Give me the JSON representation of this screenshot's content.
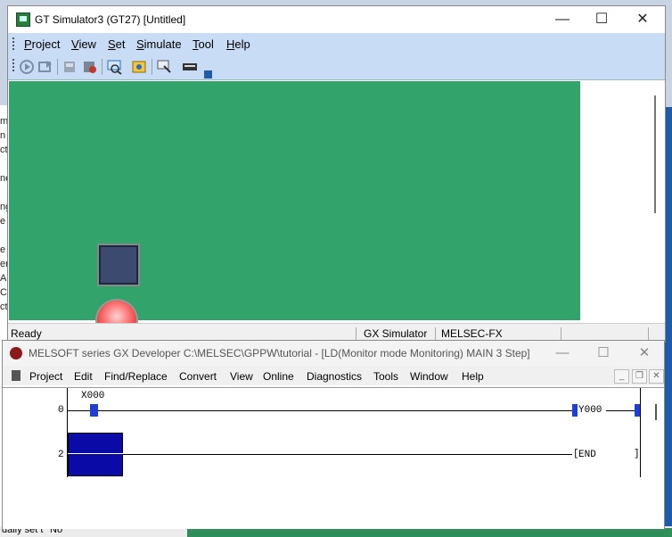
{
  "background": {
    "left_fragments": [
      "m",
      "n",
      "ct",
      "ne",
      "ng",
      "e",
      "e",
      "er",
      "A",
      "Co",
      "ct"
    ],
    "bottom_left_text": "daily set t",
    "bottom_left_value": "No"
  },
  "gt_window": {
    "title": "GT Simulator3 (GT27)  [Untitled]",
    "controls": {
      "minimize": "—",
      "maximize": "☐",
      "close": "✕"
    },
    "menu": [
      "Project",
      "View",
      "Set",
      "Simulate",
      "Tool",
      "Help"
    ],
    "menu_mnemonics": [
      "P",
      "V",
      "S",
      "S",
      "T",
      "H"
    ],
    "toolbar_icons": [
      "start-icon",
      "stop-icon",
      "read-icon",
      "write-icon",
      "device-monitor-icon",
      "snapshot-icon",
      "touch-icon",
      "keyboard-icon"
    ],
    "screen_color": "#31a36b",
    "status": {
      "left": "Ready",
      "center": "GX Simulator",
      "right": "MELSEC-FX"
    }
  },
  "gx_window": {
    "title": "MELSOFT series GX Developer C:\\MELSEC\\GPPW\\tutorial - [LD(Monitor mode Monitoring)    MAIN    3 Step]",
    "controls": {
      "minimize": "—",
      "maximize": "☐",
      "close": "✕"
    },
    "menu": [
      "Project",
      "Edit",
      "Find/Replace",
      "Convert",
      "View",
      "Online",
      "Diagnostics",
      "Tools",
      "Window",
      "Help"
    ],
    "mdi_controls": {
      "minimize": "_",
      "restore": "❐",
      "close": "✕"
    },
    "ladder": {
      "rungs": [
        {
          "step": "0",
          "contact": "X000",
          "coil": "Y000"
        },
        {
          "step": "2",
          "instruction": "END"
        }
      ]
    }
  }
}
